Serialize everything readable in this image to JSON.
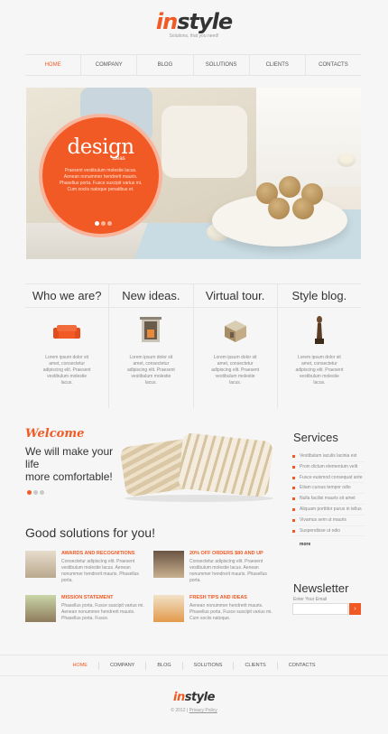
{
  "header": {
    "logo_in": "in",
    "logo_style": "style",
    "tagline": "Solutions, that you need!"
  },
  "nav": [
    "HOME",
    "COMPANY",
    "BLOG",
    "SOLUTIONS",
    "CLIENTS",
    "CONTACTS"
  ],
  "hero": {
    "title": "design",
    "subtitle": "ideas",
    "text": "Praesent vestibulum molestie lacus. Aenean nonummer hendrerit mauris. Phasellus porta. Fusce suscipit varius mi. Cum sociis natoque penatibus et."
  },
  "boxes": [
    {
      "title": "Who we are?",
      "icon": "sofa-icon",
      "text": "Lorem ipsum dolor sit amet, consectetur adipiscing elit. Praesent vestibulum molestie lacus."
    },
    {
      "title": "New ideas.",
      "icon": "fireplace-icon",
      "text": "Lorem ipsum dolor sit amet, consectetur adipiscing elit. Praesent vestibulum molestie lacus."
    },
    {
      "title": "Virtual tour.",
      "icon": "furniture-icon",
      "text": "Lorem ipsum dolor sit amet, consectetur adipiscing elit. Praesent vestibulum molestie lacus."
    },
    {
      "title": "Style blog.",
      "icon": "sculpture-icon",
      "text": "Lorem ipsum dolor sit amet, consectetur adipiscing elit. Praesent vestibulum molestie lacus."
    }
  ],
  "welcome": {
    "title": "Welcome",
    "line1": "We will make your life",
    "line2": "more comfortable!"
  },
  "services": {
    "title": "Services",
    "items": [
      "Vestibulum iaculis lacinia est",
      "Proin dictum elementum velit",
      "Fusce euismod consequat ante",
      "Etiam cursus tempor odio",
      "Nulla facilisi mauris sit amet",
      "Aliquam porttitor purus in tellus",
      "Vivamus sem ut mauris",
      "Suspendisse ut odio"
    ],
    "more": "more"
  },
  "solutions": {
    "title": "Good solutions for you!",
    "items": [
      {
        "title": "AWARDS AND RECOGNITIONS",
        "text": "Consectetur adipiscing elit. Praesent vestibulum molestie lacus. Aenean nonummer hendrerit mauris. Phasellus porta."
      },
      {
        "title": "20% OFF ORDERS $80 AND UP",
        "text": "Consectetur adipiscing elit. Praesent vestibulum molestie lacus. Aenean nonummer hendrerit mauris. Phasellus porta."
      },
      {
        "title": "MISSION STATEMENT",
        "text": "Phasellus porta. Fusce suscipit varius mi. Aenean nonummer hendrerit mauris. Phasellus porta. Fusce."
      },
      {
        "title": "FRESH TIPS AND IDEAS",
        "text": "Aenean nonummer hendrerit mauris. Phasellus porta. Fusce suscipit varius mi. Cum sociis natoque."
      }
    ]
  },
  "newsletter": {
    "title": "Newsletter",
    "label": "Enter Your Email",
    "button": "›"
  },
  "footer": {
    "nav": [
      "HOME",
      "COMPANY",
      "BLOG",
      "SOLUTIONS",
      "CLIENTS",
      "CONTACTS"
    ],
    "logo_in": "in",
    "logo_style": "style",
    "copyright": "© 2012 |",
    "privacy": "Privacy Policy"
  },
  "colors": {
    "accent": "#f15a24",
    "text": "#333333",
    "muted": "#888888",
    "background": "#f6f6f6"
  }
}
